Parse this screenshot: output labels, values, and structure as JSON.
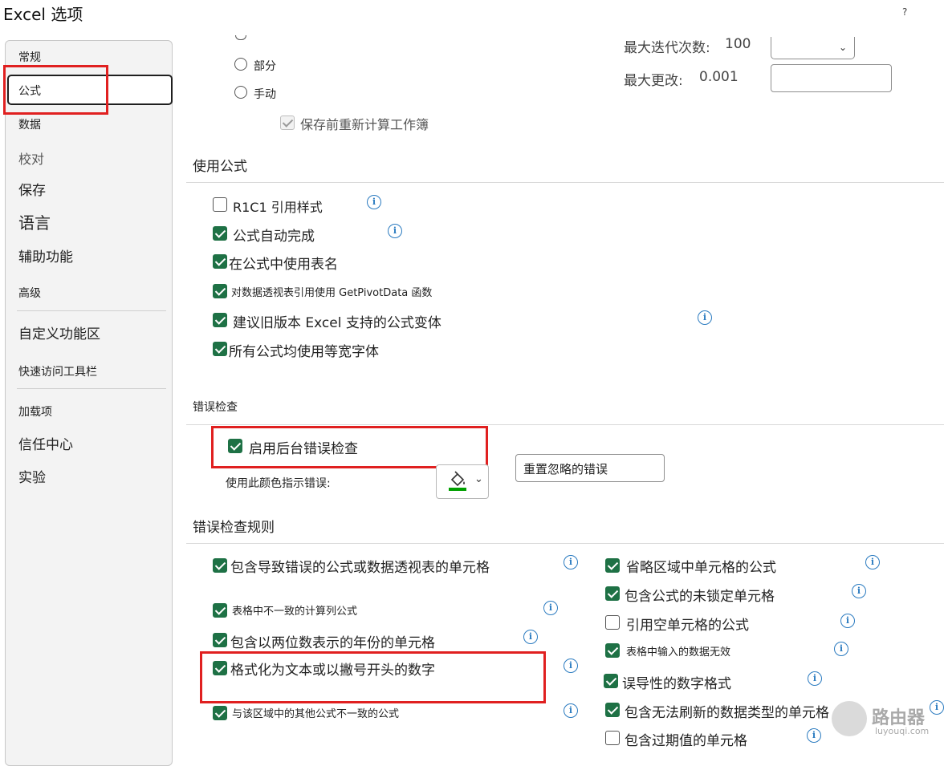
{
  "window": {
    "title": "Excel 选项",
    "help": "?"
  },
  "sidebar": {
    "items": [
      {
        "label": "常规"
      },
      {
        "label": "公式"
      },
      {
        "label": "数据"
      },
      {
        "label": "校对"
      },
      {
        "label": "保存"
      },
      {
        "label": "语言"
      },
      {
        "label": "辅助功能"
      },
      {
        "label": "高级"
      },
      {
        "label": "自定义功能区"
      },
      {
        "label": "快速访问工具栏"
      },
      {
        "label": "加载项"
      },
      {
        "label": "信任中心"
      },
      {
        "label": "实验"
      }
    ],
    "selected": "公式"
  },
  "calc": {
    "radio_partial": "部分",
    "radio_manual": "手动",
    "save_before": "保存前重新计算工作簿",
    "max_iter_label": "最大迭代次数:",
    "max_iter_value": "100",
    "max_change_label": "最大更改:",
    "max_change_value": "0.001"
  },
  "formulas": {
    "title": "使用公式",
    "items": [
      {
        "label": "R1C1 引用样式",
        "checked": false
      },
      {
        "label": "公式自动完成",
        "checked": true
      },
      {
        "label": "在公式中使用表名",
        "checked": true
      },
      {
        "label": "对数据透视表引用使用 GetPivotData 函数",
        "checked": true
      },
      {
        "label": "建议旧版本 Excel 支持的公式变体",
        "checked": true
      },
      {
        "label": "所有公式均使用等宽字体",
        "checked": true
      }
    ]
  },
  "error_check": {
    "title": "错误检查",
    "enable_bg": "启用后台错误检查",
    "color_label": "使用此颜色指示错误:",
    "reset_button": "重置忽略的错误"
  },
  "rules": {
    "title": "错误检查规则",
    "left": [
      {
        "label": "包含导致错误的公式或数据透视表的单元格",
        "checked": true
      },
      {
        "label": "表格中不一致的计算列公式",
        "checked": true
      },
      {
        "label": "包含以两位数表示的年份的单元格",
        "checked": true
      },
      {
        "label": "格式化为文本或以撇号开头的数字",
        "checked": true
      },
      {
        "label": "与该区域中的其他公式不一致的公式",
        "checked": true
      }
    ],
    "right": [
      {
        "label": "省略区域中单元格的公式",
        "checked": true
      },
      {
        "label": "包含公式的未锁定单元格",
        "checked": true
      },
      {
        "label": "引用空单元格的公式",
        "checked": false
      },
      {
        "label": "表格中输入的数据无效",
        "checked": true
      },
      {
        "label": "误导性的数字格式",
        "checked": true
      },
      {
        "label": "包含无法刷新的数据类型的单元格",
        "checked": true
      },
      {
        "label": "包含过期值的单元格",
        "checked": false
      }
    ]
  },
  "watermark": {
    "brand": "路由器",
    "site": "luyouqi.com"
  },
  "colors": {
    "accent": "#1e7145",
    "highlight": "#e02020",
    "info": "#2b7bc0",
    "error_color": "#00a000"
  }
}
